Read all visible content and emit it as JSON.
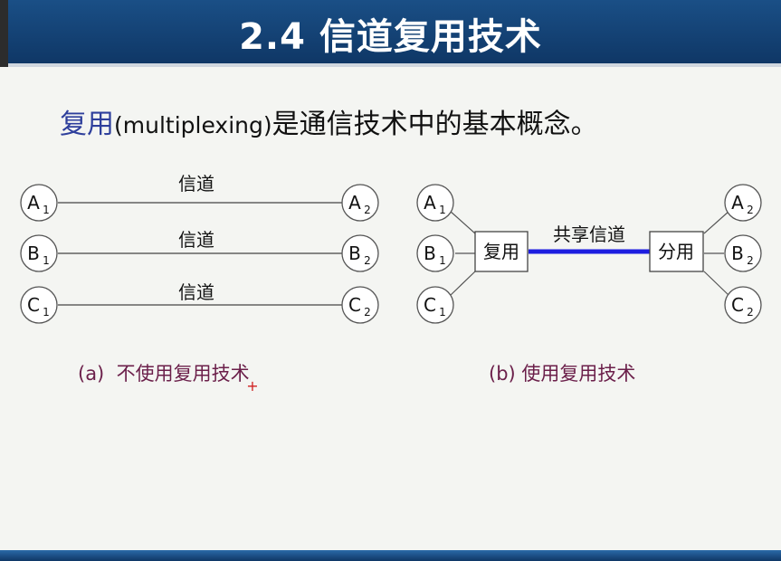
{
  "slide": {
    "title": "2.4 信道复用技术",
    "intro_keyword": "复用",
    "intro_paren": "(multiplexing)",
    "intro_rest": "是通信技术中的基本概念。"
  },
  "diagram_a": {
    "channel_labels": [
      "信道",
      "信道",
      "信道"
    ],
    "left_nodes": [
      {
        "letter": "A",
        "sub": "1"
      },
      {
        "letter": "B",
        "sub": "1"
      },
      {
        "letter": "C",
        "sub": "1"
      }
    ],
    "right_nodes": [
      {
        "letter": "A",
        "sub": "2"
      },
      {
        "letter": "B",
        "sub": "2"
      },
      {
        "letter": "C",
        "sub": "2"
      }
    ],
    "caption": "(a)  不使用复用技术"
  },
  "diagram_b": {
    "left_nodes": [
      {
        "letter": "A",
        "sub": "1"
      },
      {
        "letter": "B",
        "sub": "1"
      },
      {
        "letter": "C",
        "sub": "1"
      }
    ],
    "right_nodes": [
      {
        "letter": "A",
        "sub": "2"
      },
      {
        "letter": "B",
        "sub": "2"
      },
      {
        "letter": "C",
        "sub": "2"
      }
    ],
    "mux_label": "复用",
    "demux_label": "分用",
    "shared_channel_label": "共享信道",
    "caption": "(b) 使用复用技术"
  },
  "colors": {
    "header": "#1a4f86",
    "keyword": "#2e3f9c",
    "caption": "#6b1f4a",
    "shared_channel": "#1d1de0",
    "node_border": "#555555"
  }
}
